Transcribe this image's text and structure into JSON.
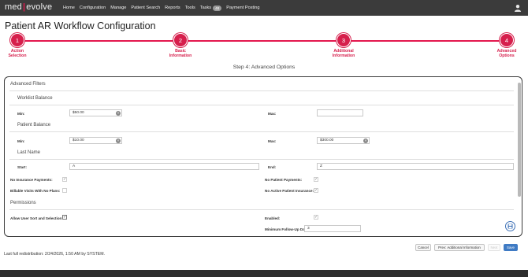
{
  "app": {
    "logo_part1": "med",
    "logo_sep": "|",
    "logo_part2": "evolve"
  },
  "nav": {
    "items": [
      "Home",
      "Configuration",
      "Manage",
      "Patient Search",
      "Reports",
      "Tools",
      "Tasks",
      "Payment Posting"
    ],
    "tasks_badge": "48"
  },
  "page": {
    "title": "Patient AR Workflow Configuration",
    "step_heading": "Step 4: Advanced Options"
  },
  "stepper": {
    "steps": [
      {
        "number": "1",
        "line1": "Action",
        "line2": "Selection"
      },
      {
        "number": "2",
        "line1": "Basic",
        "line2": "Information"
      },
      {
        "number": "3",
        "line1": "Additional",
        "line2": "Information"
      },
      {
        "number": "4",
        "line1": "Advanced",
        "line2": "Options"
      }
    ]
  },
  "advanced_filters": {
    "title": "Advanced Filters",
    "worklist_balance": {
      "title": "Worklist Balance",
      "min_label": "Min:",
      "min_value": "$50.00",
      "max_label": "Max:",
      "max_value": ""
    },
    "patient_balance": {
      "title": "Patient Balance",
      "min_label": "Min:",
      "min_value": "$10.00",
      "max_label": "Max:",
      "max_value": "$300.00"
    },
    "last_name": {
      "title": "Last Name",
      "start_label": "Start:",
      "start_value": "A",
      "end_label": "End:",
      "end_value": "Z"
    },
    "checks": {
      "no_insurance_payments": "No Insurance Payments:",
      "no_patient_payments": "No Patient Payments:",
      "billable_visits_no_plans": "Billable Visits With No Plans:",
      "no_active_patient_insurance": "No Active Patient Insurance:"
    }
  },
  "permissions": {
    "title": "Permissions",
    "allow_user_sort_label": "Allow User Sort and Selection:",
    "enabled_label": "Enabled:",
    "min_followup_label": "Minimum Follow-Up Days:",
    "min_followup_required": "*",
    "min_followup_value": "3"
  },
  "footer": {
    "last_redistribution": "Last full redistribution: 2/24/2026, 1:50 AM by SYSTEM.",
    "cancel": "Cancel",
    "prev": "Prev: Additional Information",
    "next": "Next",
    "save": "Save"
  },
  "colors": {
    "accent": "#d61f4c",
    "nav_bg": "#3b3b3b",
    "save_btn": "#3f7bc4"
  }
}
